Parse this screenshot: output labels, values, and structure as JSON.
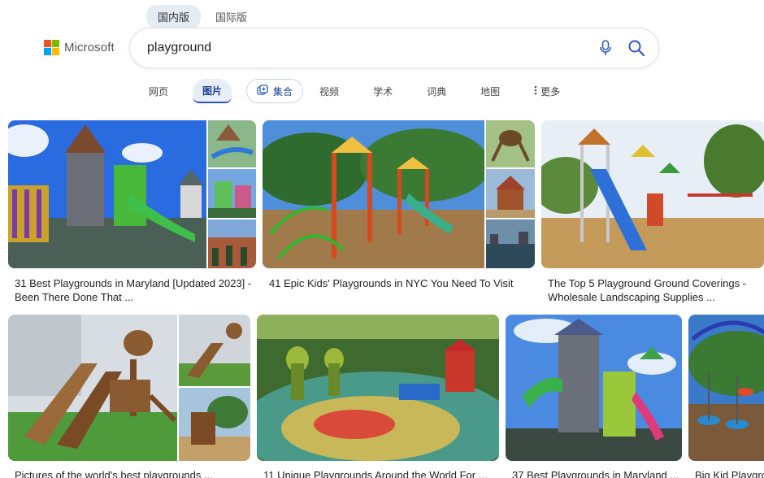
{
  "market_tabs": [
    {
      "label": "国内版",
      "active": true
    },
    {
      "label": "国际版",
      "active": false
    }
  ],
  "logo": {
    "text": "Microsoft",
    "colors": [
      "#f25022",
      "#7fba00",
      "#00a4ef",
      "#ffb900"
    ]
  },
  "search": {
    "query": "playground"
  },
  "scopes": [
    {
      "label": "网页"
    },
    {
      "label": "图片",
      "active": true
    },
    {
      "label": "集合"
    },
    {
      "label": "视频"
    },
    {
      "label": "学术"
    },
    {
      "label": "词典"
    },
    {
      "label": "地图"
    },
    {
      "label": "更多"
    }
  ],
  "results": [
    {
      "caption": "31 Best Playgrounds in Maryland [Updated 2023] - Been There Done That ..."
    },
    {
      "caption": "41 Epic Kids' Playgrounds in NYC You Need To Visit"
    },
    {
      "caption": "The Top 5 Playground Ground Coverings - Wholesale Landscaping Supplies ..."
    },
    {
      "caption": "Pictures of the world's best playgrounds ..."
    },
    {
      "caption": "11 Unique Playgrounds Around the World For ..."
    },
    {
      "caption": "37 Best Playgrounds in Maryland ..."
    },
    {
      "caption": "Big Kid Playgro..."
    }
  ],
  "colors": {
    "accent": "#2b58c4",
    "active_tab_bg": "#e8edf7"
  }
}
